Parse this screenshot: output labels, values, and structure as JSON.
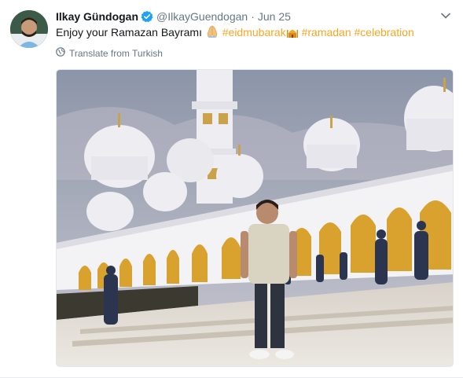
{
  "tweet": {
    "author_name": "Ilkay Gündogan",
    "handle": "@IlkayGuendogan",
    "separator": "·",
    "date": "Jun 25",
    "text_plain": "Enjoy your Ramazan Bayramı",
    "hashtag_1": "#eidmubarak",
    "hashtag_2": "#ramadan",
    "hashtag_3": "#celebration",
    "translate_label": "Translate from Turkish"
  },
  "icons": {
    "verified": "verified-badge-icon",
    "caret": "chevron-down-icon",
    "globe": "globe-icon",
    "emoji_1": "folded-hands-emoji",
    "emoji_2": "mosque-emoji"
  },
  "colors": {
    "hashtag": "#f5a623",
    "verified": "#1da1f2",
    "secondary_text": "#657786"
  }
}
